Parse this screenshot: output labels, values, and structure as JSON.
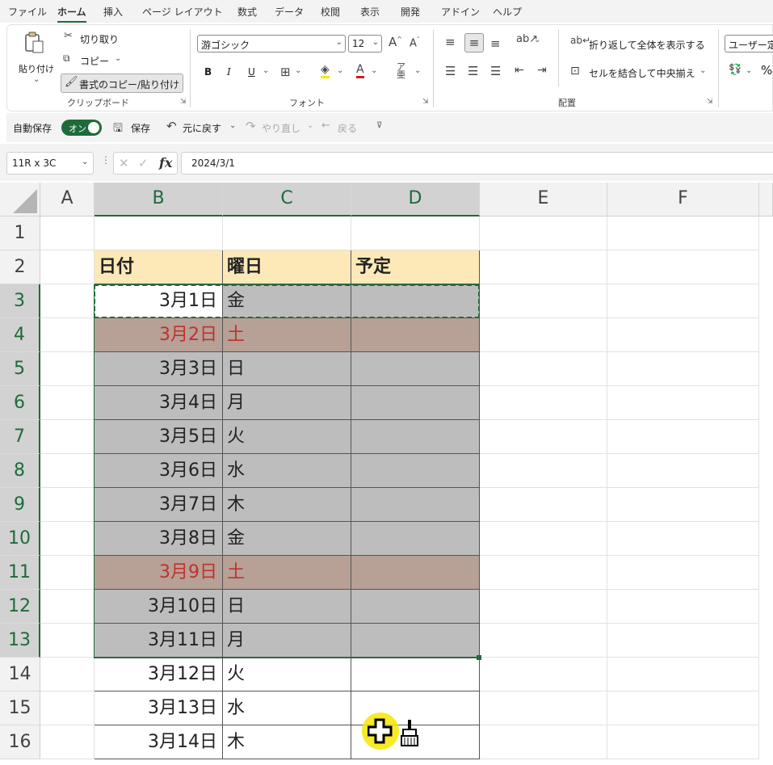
{
  "menu": {
    "tabs": [
      "ファイル",
      "ホーム",
      "挿入",
      "ページ レイアウト",
      "数式",
      "データ",
      "校閲",
      "表示",
      "開発",
      "アドイン",
      "ヘルプ"
    ],
    "active_tab": "ホーム"
  },
  "ribbon": {
    "clipboard": {
      "paste": "貼り付け",
      "cut": "切り取り",
      "copy": "コピー",
      "format_painter": "書式のコピー/貼り付け",
      "group_label": "クリップボード"
    },
    "font": {
      "font_name": "游ゴシック",
      "font_size": "12",
      "bold": "B",
      "italic": "I",
      "underline": "U",
      "group_label": "フォント"
    },
    "alignment": {
      "wrap_text": "折り返して全体を表示する",
      "merge_center": "セルを結合して中央揃え",
      "group_label": "配置"
    },
    "number": {
      "format": "ユーザー定",
      "percent": "%"
    }
  },
  "qat": {
    "autosave_label": "自動保存",
    "autosave_state": "オン",
    "save": "保存",
    "undo": "元に戻す",
    "redo": "やり直し",
    "back": "戻る"
  },
  "formula_bar": {
    "name_box": "11R x 3C",
    "fx": "fx",
    "value": "2024/3/1"
  },
  "sheet": {
    "columns": [
      "A",
      "B",
      "C",
      "D",
      "E",
      "F"
    ],
    "rows": [
      "1",
      "2",
      "3",
      "4",
      "5",
      "6",
      "7",
      "8",
      "9",
      "10",
      "11",
      "12",
      "13",
      "14",
      "15",
      "16"
    ],
    "header": {
      "date": "日付",
      "weekday": "曜日",
      "plan": "予定"
    },
    "data": [
      {
        "date": "3月1日",
        "weekday": "金"
      },
      {
        "date": "3月2日",
        "weekday": "土"
      },
      {
        "date": "3月3日",
        "weekday": "日"
      },
      {
        "date": "3月4日",
        "weekday": "月"
      },
      {
        "date": "3月5日",
        "weekday": "火"
      },
      {
        "date": "3月6日",
        "weekday": "水"
      },
      {
        "date": "3月7日",
        "weekday": "木"
      },
      {
        "date": "3月8日",
        "weekday": "金"
      },
      {
        "date": "3月9日",
        "weekday": "土"
      },
      {
        "date": "3月10日",
        "weekday": "日"
      },
      {
        "date": "3月11日",
        "weekday": "月"
      },
      {
        "date": "3月12日",
        "weekday": "火"
      },
      {
        "date": "3月13日",
        "weekday": "水"
      },
      {
        "date": "3月14日",
        "weekday": "木"
      }
    ]
  },
  "colors": {
    "accent": "#1e6b3a",
    "header_fill": "#fde9b8",
    "saturday_text": "#c0312c",
    "selection_fill": "#bdbdbd",
    "saturday_selection_fill": "#b7a096",
    "cursor_highlight": "#f7e600"
  },
  "icons": [
    "paste-icon",
    "scissors-icon",
    "copy-icon",
    "paintbrush-icon",
    "save-icon",
    "undo-icon",
    "redo-icon",
    "back-arrow-icon",
    "format-painter-cursor-icon"
  ]
}
